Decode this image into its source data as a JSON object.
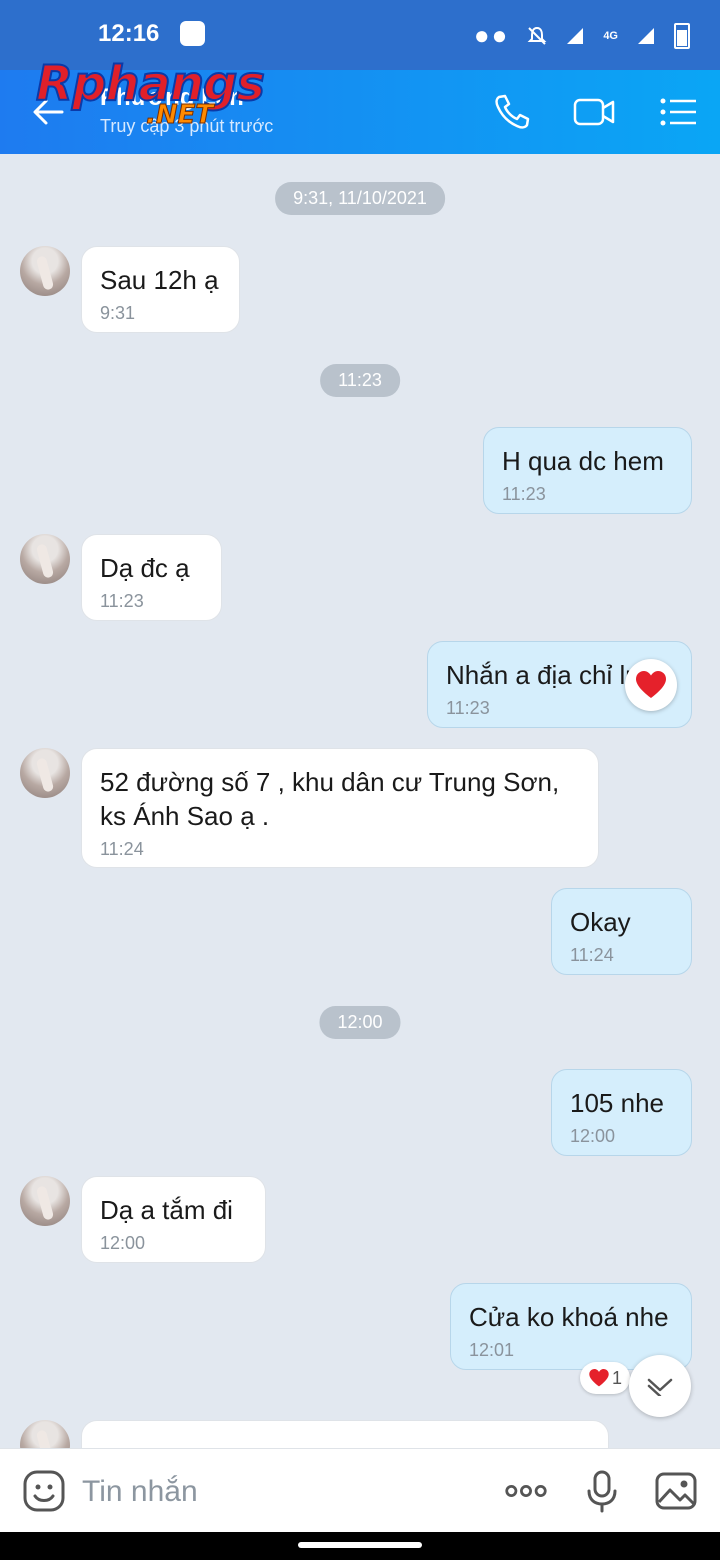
{
  "status_bar": {
    "time": "12:16",
    "network": "4G"
  },
  "header": {
    "contact_name": "Phương Lan",
    "contact_status": "Truy cập 3 phút trước",
    "watermark_main": "Rphangs",
    "watermark_sub": ".NET"
  },
  "chat": {
    "time_pills": [
      "9:31, 11/10/2021",
      "11:23",
      "12:00"
    ],
    "messages": [
      {
        "direction": "in",
        "text": "Sau 12h ạ",
        "time": "9:31"
      },
      {
        "direction": "out",
        "text": "H qua dc hem",
        "time": "11:23"
      },
      {
        "direction": "in",
        "text": "Dạ đc ạ",
        "time": "11:23"
      },
      {
        "direction": "out",
        "text": "Nhắn a địa chỉ lun",
        "time": "11:23",
        "reaction": "heart"
      },
      {
        "direction": "in",
        "text": "52 đường số 7 , khu dân cư Trung Sơn, ks Ánh Sao ạ .",
        "time": "11:24"
      },
      {
        "direction": "out",
        "text": "Okay",
        "time": "11:24"
      },
      {
        "direction": "out",
        "text": "105 nhe",
        "time": "12:00"
      },
      {
        "direction": "in",
        "text": "Dạ a tắm đi",
        "time": "12:00"
      },
      {
        "direction": "out",
        "text": "Cửa ko khoá nhe",
        "time": "12:01",
        "reaction_count": "1"
      }
    ]
  },
  "composer": {
    "placeholder": "Tin nhắn"
  },
  "colors": {
    "header_start": "#1e7bf0",
    "header_end": "#0aa6f5",
    "outgoing_bubble": "#d5eefc",
    "incoming_bubble": "#ffffff",
    "chat_bg": "#e2e8f0"
  },
  "icons": [
    "back-arrow-icon",
    "phone-icon",
    "video-call-icon",
    "menu-list-icon",
    "sticker-icon",
    "more-icon",
    "mic-icon",
    "image-icon",
    "heart-icon",
    "chevron-down-icon"
  ]
}
